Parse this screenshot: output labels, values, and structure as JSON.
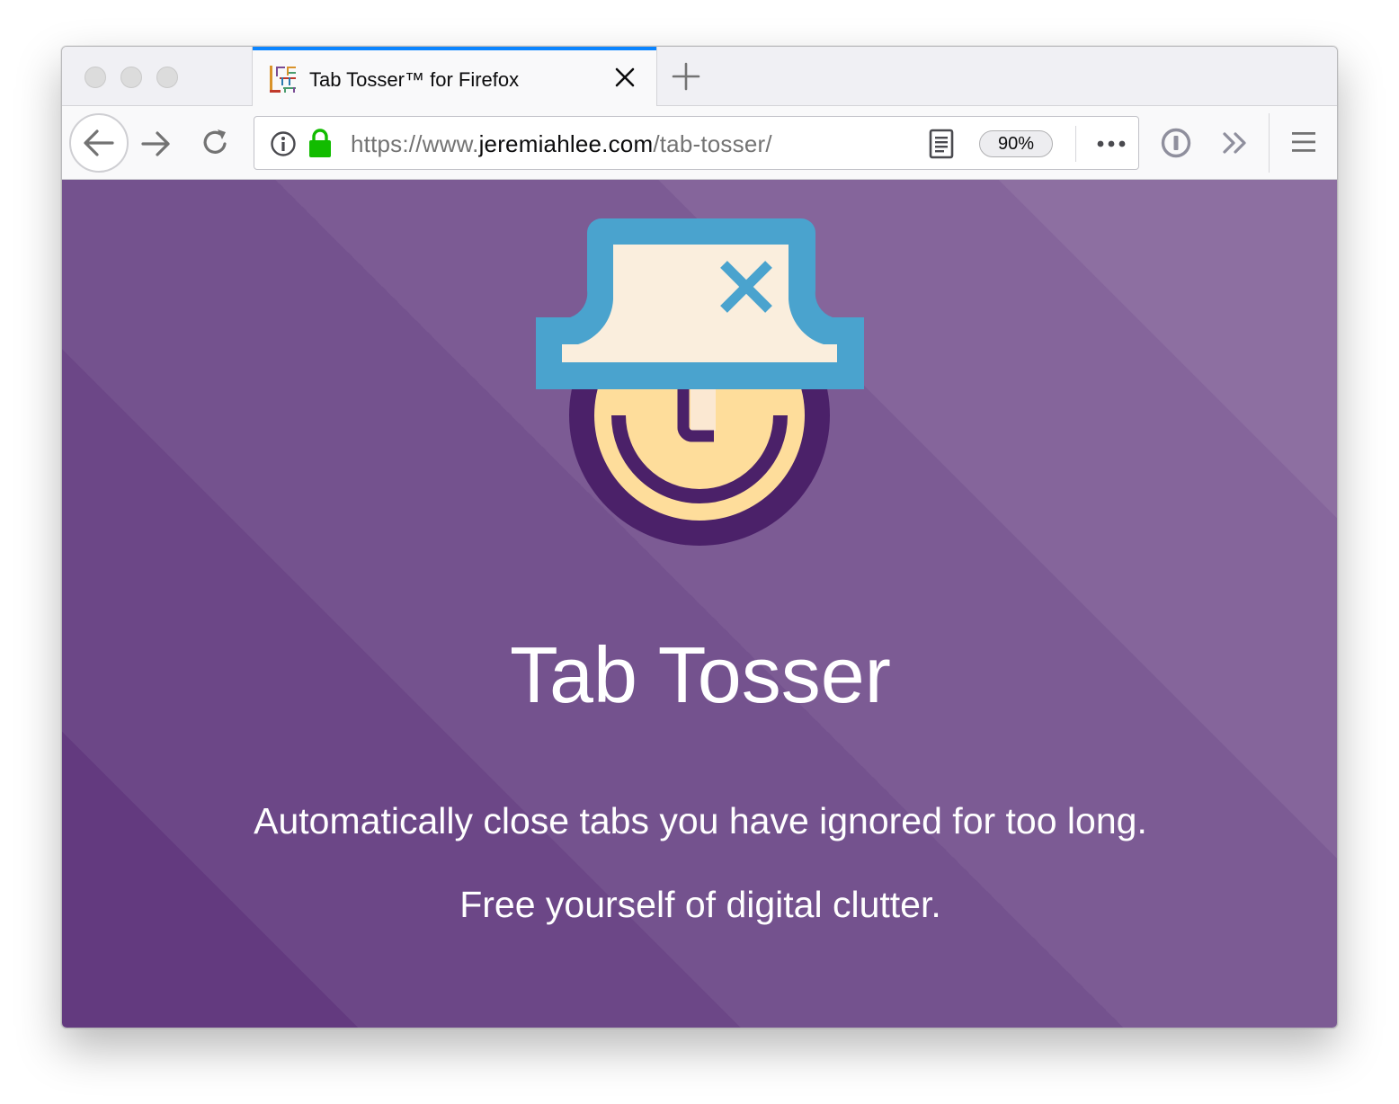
{
  "tab": {
    "title": "Tab Tosser™ for Firefox",
    "favicon_icon": "jeremiahlee-logo-icon",
    "close_icon": "close-icon"
  },
  "toolbar": {
    "new_tab_icon": "plus-icon",
    "back_icon": "arrow-left-icon",
    "forward_icon": "arrow-right-icon",
    "reload_icon": "reload-icon",
    "info_icon": "info-icon",
    "lock_icon": "lock-icon",
    "reader_icon": "reader-view-icon",
    "more_icon": "ellipsis-icon",
    "password_icon": "1password-icon",
    "overflow_icon": "chevrons-right-icon",
    "menu_icon": "hamburger-menu-icon"
  },
  "urlbar": {
    "prefix": "https://www.",
    "domain": "jeremiahlee.com",
    "path": "/tab-tosser/",
    "zoom": "90%"
  },
  "page": {
    "title": "Tab Tosser",
    "tagline": "Automatically close tabs you have ignored for too long.",
    "subtagline": "Free yourself of digital clutter."
  },
  "colors": {
    "tab_accent": "#0a84ff",
    "lock_green": "#12bc00",
    "background_purple": "#74528e",
    "hat_blue": "#4aa3ce",
    "hat_cream": "#faeedd",
    "clock_dark": "#4b2169",
    "clock_face": "#fedd9b"
  }
}
